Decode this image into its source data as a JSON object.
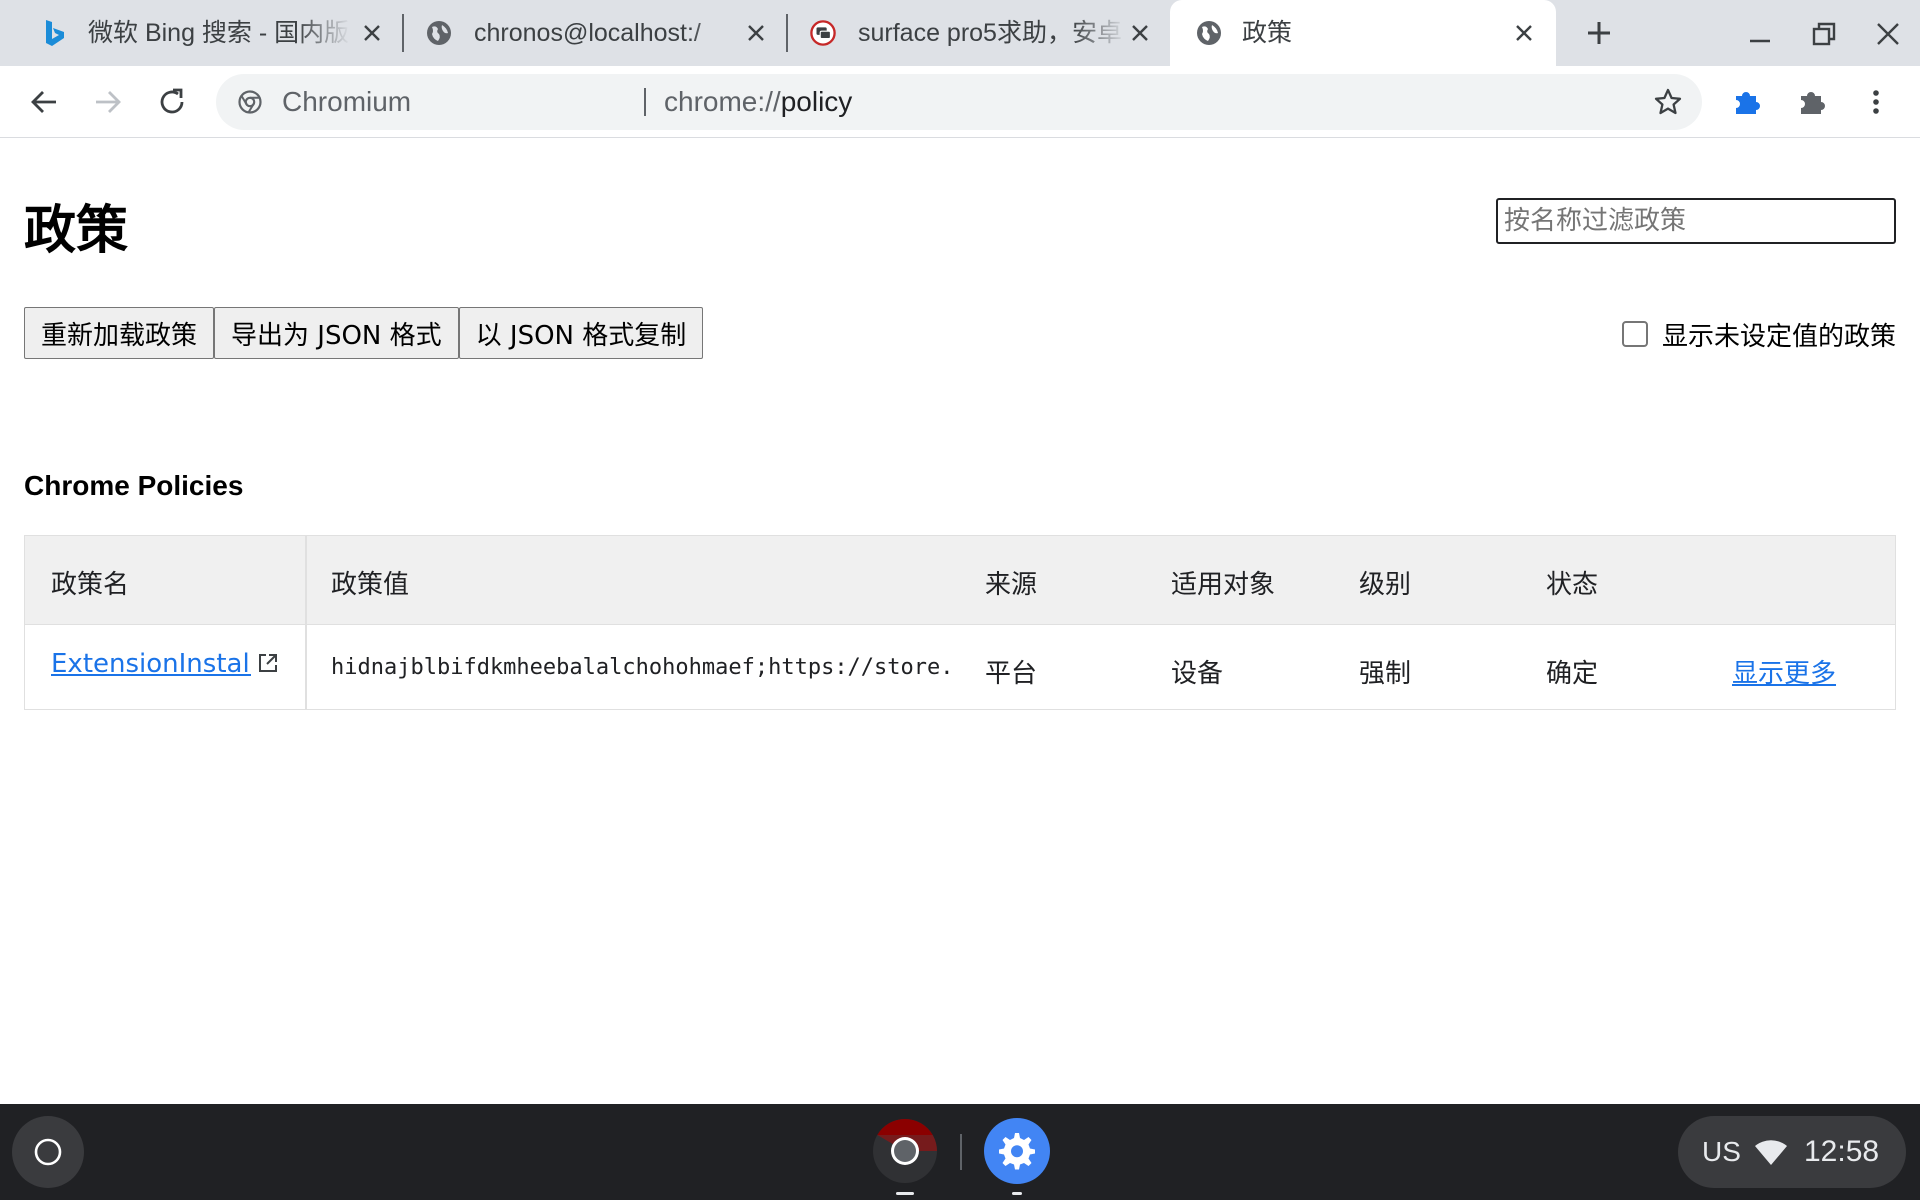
{
  "browser": {
    "tabs": [
      {
        "title": "微软 Bing 搜索 - 国内版",
        "icon": "bing-icon",
        "active": false
      },
      {
        "title": "chronos@localhost:/",
        "icon": "globe-icon",
        "active": false
      },
      {
        "title": "surface pro5求助，安卓",
        "icon": "forum-icon",
        "active": false
      },
      {
        "title": "政策",
        "icon": "globe-icon",
        "active": true
      }
    ],
    "omnibox": {
      "chip": "Chromium",
      "scheme": "chrome://",
      "host": "policy"
    }
  },
  "page": {
    "title": "政策",
    "filter_placeholder": "按名称过滤政策",
    "buttons": {
      "reload": "重新加载政策",
      "export_json": "导出为 JSON 格式",
      "copy_json": "以 JSON 格式复制"
    },
    "show_unset_label": "显示未设定值的政策",
    "section_title": "Chrome Policies",
    "table": {
      "headers": {
        "name": "政策名",
        "value": "政策值",
        "source": "来源",
        "scope": "适用对象",
        "level": "级别",
        "status": "状态"
      },
      "rows": [
        {
          "name": "ExtensionInstall…",
          "value": "hidnajblbifdkmheebalalchohohmaef;https://store.f…",
          "source": "平台",
          "scope": "设备",
          "level": "强制",
          "status": "确定",
          "more": "显示更多"
        }
      ]
    }
  },
  "shelf": {
    "ime": "US",
    "time": "12:58"
  },
  "colors": {
    "accent_blue": "#1a73e8",
    "tab_strip": "#dee1e6",
    "shelf": "#202124"
  }
}
